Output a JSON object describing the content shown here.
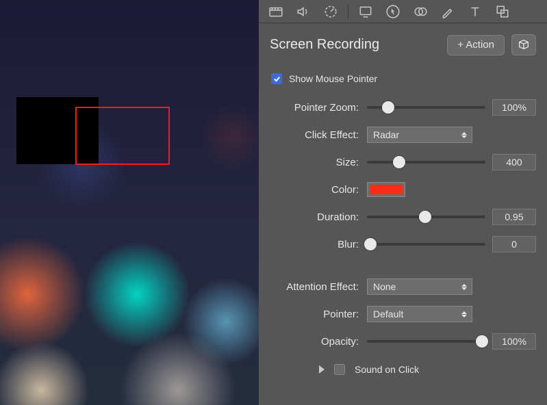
{
  "panel": {
    "title": "Screen Recording",
    "add_action_label": "+ Action"
  },
  "show_pointer": {
    "label": "Show Mouse Pointer",
    "checked": true
  },
  "pointer_zoom": {
    "label": "Pointer Zoom:",
    "value": "100%",
    "pos_pct": 18
  },
  "click_effect": {
    "label": "Click Effect:",
    "selected": "Radar"
  },
  "size": {
    "label": "Size:",
    "value": "400",
    "pos_pct": 27
  },
  "color": {
    "label": "Color:",
    "hex": "#ff2a17"
  },
  "duration": {
    "label": "Duration:",
    "value": "0.95",
    "pos_pct": 49
  },
  "blur": {
    "label": "Blur:",
    "value": "0",
    "pos_pct": 3
  },
  "attention": {
    "label": "Attention Effect:",
    "selected": "None"
  },
  "pointer_type": {
    "label": "Pointer:",
    "selected": "Default"
  },
  "opacity": {
    "label": "Opacity:",
    "value": "100%",
    "pos_pct": 97
  },
  "sound_on_click": {
    "label": "Sound on Click",
    "checked": false
  },
  "toolbar_icons": [
    "video",
    "audio",
    "trim",
    "display",
    "cursor",
    "overlap",
    "draw",
    "text",
    "group"
  ]
}
